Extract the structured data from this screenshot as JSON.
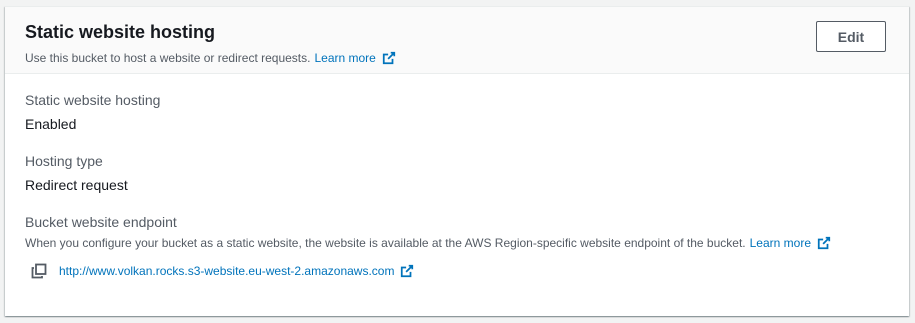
{
  "header": {
    "title": "Static website hosting",
    "description": "Use this bucket to host a website or redirect requests.",
    "learn_more": "Learn more",
    "edit_label": "Edit"
  },
  "fields": {
    "hosting": {
      "label": "Static website hosting",
      "value": "Enabled"
    },
    "hosting_type": {
      "label": "Hosting type",
      "value": "Redirect request"
    },
    "endpoint": {
      "label": "Bucket website endpoint",
      "description": "When you configure your bucket as a static website, the website is available at the AWS Region-specific website endpoint of the bucket.",
      "learn_more": "Learn more",
      "url": "http://www.volkan.rocks.s3-website.eu-west-2.amazonaws.com"
    }
  },
  "icons": {
    "external": "external-link-icon",
    "copy": "copy-icon"
  },
  "colors": {
    "link": "#0073bb",
    "text": "#16191f",
    "secondary_text": "#545b64",
    "header_bg": "#fafafa",
    "page_bg": "#f2f3f3"
  }
}
